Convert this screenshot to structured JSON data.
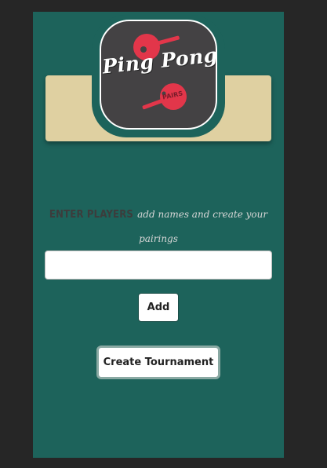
{
  "logo": {
    "title": "Ping Pong",
    "subtitle": "PAIRS"
  },
  "instructions": {
    "title": "ENTER PLAYERS",
    "subtitle": "add names and create your pairings"
  },
  "player_input": {
    "value": "",
    "placeholder": ""
  },
  "buttons": {
    "add_label": "Add",
    "create_label": "Create Tournament"
  },
  "colors": {
    "page_background": "#262626",
    "app_background": "#1d635b",
    "banner": "#dfd0a1",
    "logo_background": "#444244",
    "paddle_red": "#e2364a"
  }
}
